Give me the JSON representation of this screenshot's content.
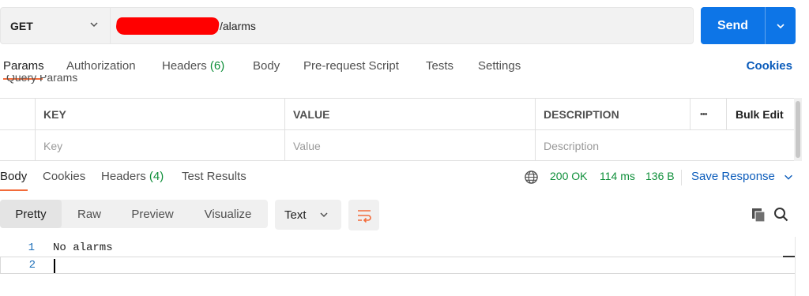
{
  "request": {
    "method": "GET",
    "url_suffix": "/alarms",
    "send_label": "Send"
  },
  "request_tabs": [
    {
      "label": "Params",
      "count": ""
    },
    {
      "label": "Authorization",
      "count": ""
    },
    {
      "label": "Headers",
      "count": "(6)"
    },
    {
      "label": "Body",
      "count": ""
    },
    {
      "label": "Pre-request Script",
      "count": ""
    },
    {
      "label": "Tests",
      "count": ""
    },
    {
      "label": "Settings",
      "count": ""
    }
  ],
  "cookies_link": "Cookies",
  "query_params_label": "Query Params",
  "params_table": {
    "headers": [
      "KEY",
      "VALUE",
      "DESCRIPTION",
      "Bulk Edit"
    ],
    "more_glyph": "•••",
    "placeholders": [
      "Key",
      "Value",
      "Description"
    ]
  },
  "response_tabs": [
    {
      "label": "Body",
      "count": ""
    },
    {
      "label": "Cookies",
      "count": ""
    },
    {
      "label": "Headers",
      "count": "(4)"
    },
    {
      "label": "Test Results",
      "count": ""
    }
  ],
  "response_meta": {
    "status": "200 OK",
    "time": "114 ms",
    "size": "136 B",
    "save_label": "Save Response"
  },
  "view_modes": [
    "Pretty",
    "Raw",
    "Preview",
    "Visualize"
  ],
  "format_select": "Text",
  "editor": {
    "lines": [
      {
        "number": "1",
        "text": "No alarms"
      },
      {
        "number": "2",
        "text": ""
      }
    ]
  },
  "colors": {
    "accent": "#0d75e7",
    "tab_indicator": "#f26b3a",
    "success": "#0f8f3a",
    "link": "#0b5cbb",
    "redaction": "#ff0000"
  },
  "icons": [
    "chevron-down-icon",
    "globe-icon",
    "wrap-lines-icon",
    "copy-icon",
    "search-icon"
  ]
}
